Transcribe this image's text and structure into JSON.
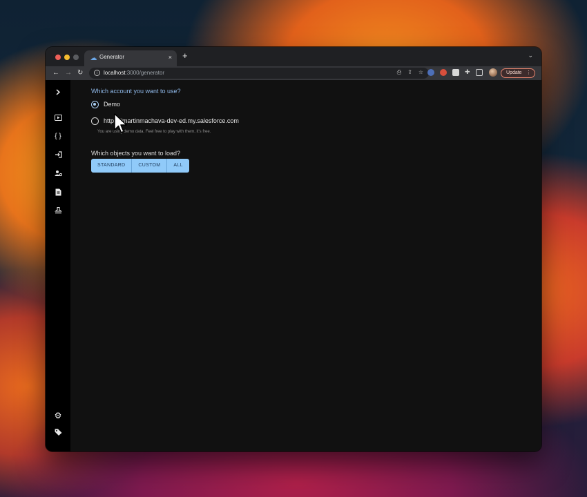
{
  "browser": {
    "tab_title": "Generator",
    "tab_close_glyph": "×",
    "new_tab_glyph": "+",
    "tab_menu_glyph": "⌄",
    "url_host": "localhost",
    "url_rest": ":3000/generator",
    "update_label": "Update",
    "update_menu_glyph": "⋮"
  },
  "form": {
    "account_question": "Which account you want to use?",
    "options": [
      {
        "label": "Demo",
        "selected": true
      },
      {
        "label": "https://martinmachava-dev-ed.my.salesforce.com",
        "selected": false
      }
    ],
    "helper_text": "You are using demo data. Feel free to play with them, it's free.",
    "objects_question": "Which objects you want to load?",
    "object_buttons": [
      "STANDARD",
      "CUSTOM",
      "ALL"
    ]
  },
  "sidebar": {
    "icons": [
      "chevron-right-icon",
      "play-icon",
      "code-braces-icon",
      "login-icon",
      "user-settings-icon",
      "file-icon",
      "stamp-icon",
      "gear-icon",
      "tag-icon"
    ]
  },
  "colors": {
    "accent": "#90caf9",
    "question": "#8fb8e8",
    "page_bg": "#111111",
    "sidebar_bg": "#000000"
  }
}
